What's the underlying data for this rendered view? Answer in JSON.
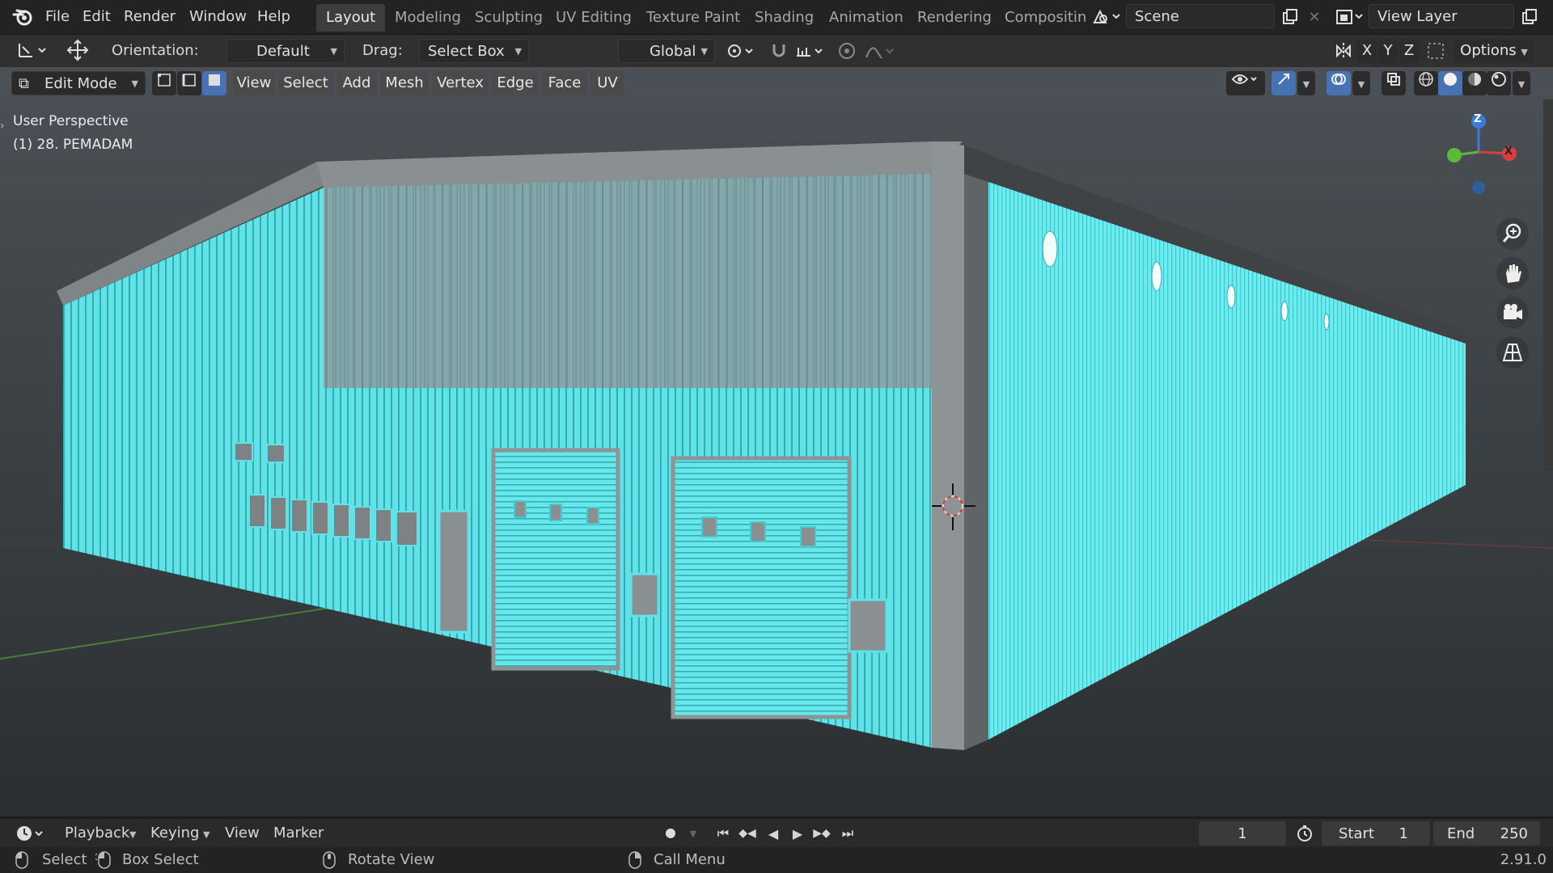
{
  "app": {
    "version": "2.91.0"
  },
  "menu": [
    "File",
    "Edit",
    "Render",
    "Window",
    "Help"
  ],
  "workspaces": [
    "Layout",
    "Modeling",
    "Sculpting",
    "UV Editing",
    "Texture Paint",
    "Shading",
    "Animation",
    "Rendering",
    "Compositin"
  ],
  "active_workspace": 0,
  "scene": {
    "name": "Scene",
    "view_layer": "View Layer"
  },
  "tool_header": {
    "orientation_label": "Orientation:",
    "orientation_value": "Default",
    "drag_label": "Drag:",
    "drag_value": "Select Box",
    "transform_orientation": "Global",
    "axes": [
      "X",
      "Y",
      "Z"
    ],
    "options_label": "Options"
  },
  "header": {
    "mode": "Edit Mode",
    "menus": [
      "View",
      "Select",
      "Add",
      "Mesh",
      "Vertex",
      "Edge",
      "Face",
      "UV"
    ]
  },
  "viewport": {
    "perspective_label": "User Perspective",
    "object_label": "(1) 28. PEMADAM",
    "gizmo_axes": {
      "z": "Z",
      "x": "X"
    },
    "colors": {
      "mesh_selected": "#64e8ec",
      "mesh_wire": "#3fb8bd",
      "grid_green": "#4f7a3a",
      "grid_red": "#7a3a3a"
    }
  },
  "timeline": {
    "menus": [
      "Playback",
      "Keying",
      "View",
      "Marker"
    ],
    "current_frame": "1",
    "start_label": "Start",
    "start_value": "1",
    "end_label": "End",
    "end_value": "250"
  },
  "status": {
    "select": "Select",
    "box_select": "Box Select",
    "rotate_view": "Rotate View",
    "call_menu": "Call Menu"
  }
}
